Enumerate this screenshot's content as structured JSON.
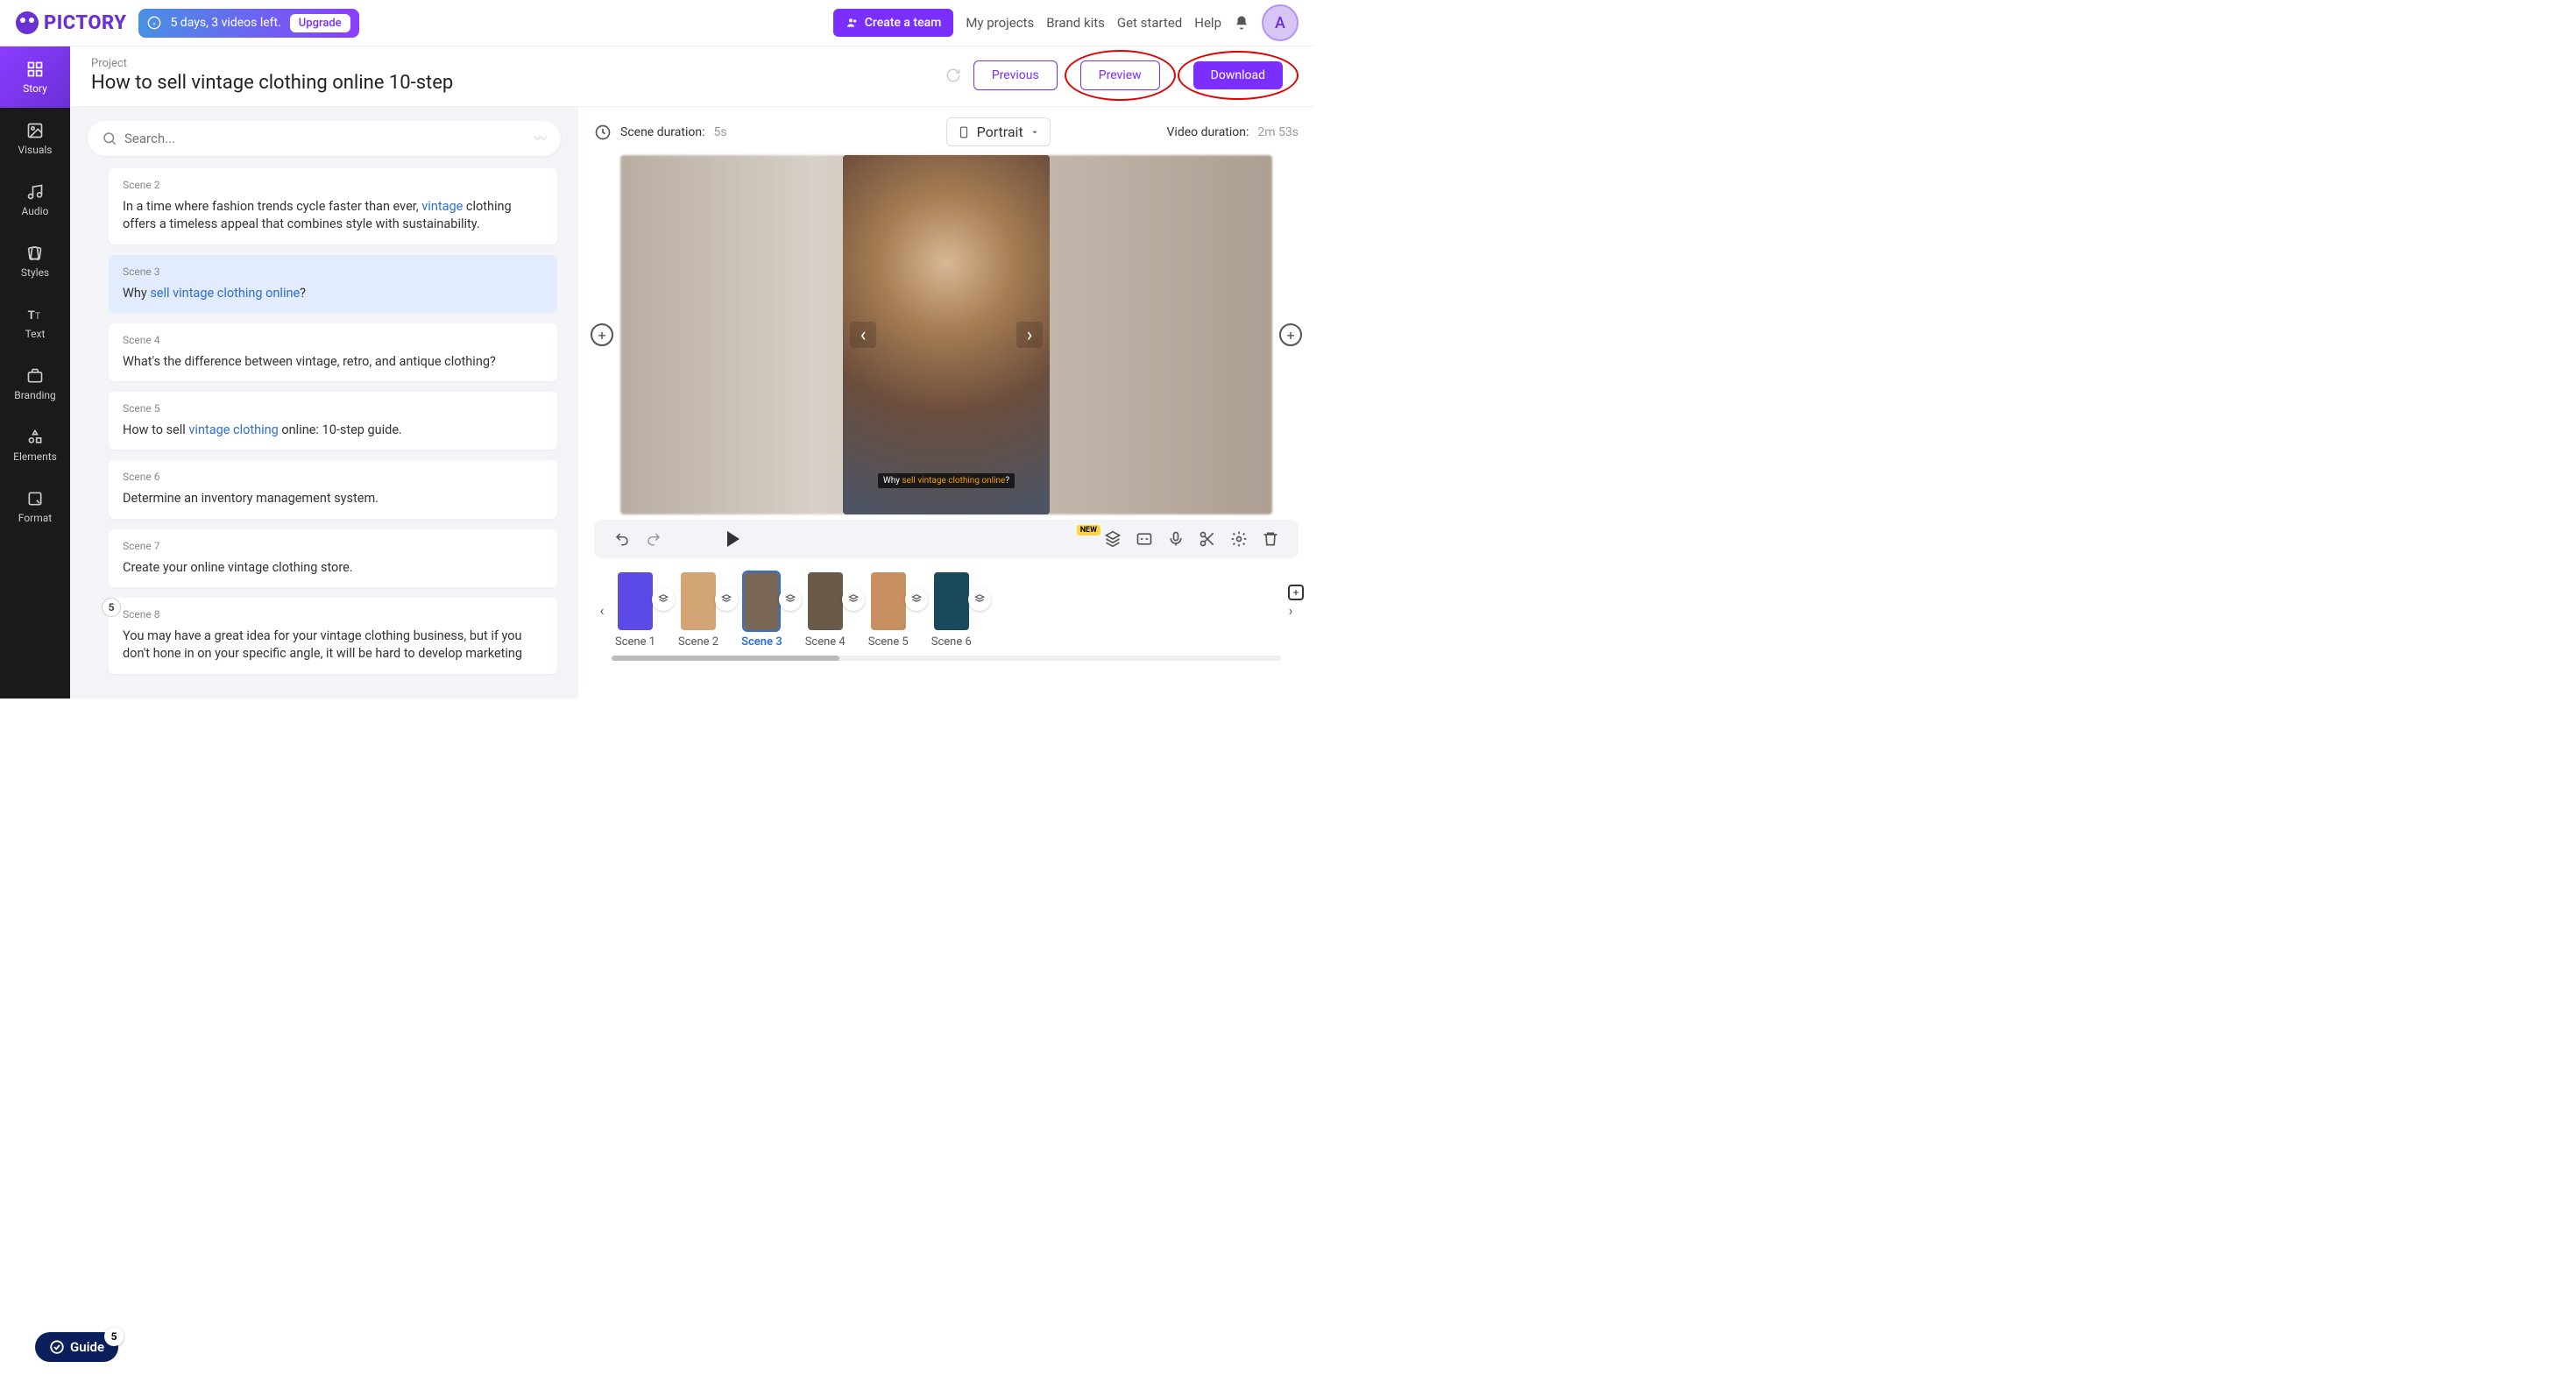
{
  "brand": "PICTORY",
  "trial": {
    "text": "5 days, 3 videos left.",
    "upgrade": "Upgrade"
  },
  "topnav": {
    "create_team": "Create a team",
    "my_projects": "My projects",
    "brand_kits": "Brand kits",
    "get_started": "Get started",
    "help": "Help"
  },
  "avatar_letter": "A",
  "project": {
    "label": "Project",
    "title": "How to sell vintage clothing online 10-step"
  },
  "header_buttons": {
    "previous": "Previous",
    "preview": "Preview",
    "download": "Download"
  },
  "sidebar": {
    "story": "Story",
    "visuals": "Visuals",
    "audio": "Audio",
    "styles": "Styles",
    "text": "Text",
    "branding": "Branding",
    "elements": "Elements",
    "format": "Format"
  },
  "search": {
    "placeholder": "Search..."
  },
  "scenes": [
    {
      "label": "Scene 2",
      "pre": "In a time where fashion trends cycle faster than ever, ",
      "hl": "vintage",
      "post": " clothing offers a timeless appeal that combines style with sustainability."
    },
    {
      "label": "Scene 3",
      "pre": "Why ",
      "hl": "sell vintage clothing online",
      "post": "?",
      "selected": true
    },
    {
      "label": "Scene 4",
      "pre": "What's the difference between vintage, retro, and antique clothing?",
      "hl": "",
      "post": ""
    },
    {
      "label": "Scene 5",
      "pre": "How to sell ",
      "hl": "vintage clothing",
      "post": " online: 10-step guide."
    },
    {
      "label": "Scene 6",
      "pre": "Determine an inventory management system.",
      "hl": "",
      "post": ""
    },
    {
      "label": "Scene 7",
      "pre": "Create your online vintage clothing store.",
      "hl": "",
      "post": ""
    },
    {
      "label": "Scene 8",
      "pre": "You may have a great idea for your vintage clothing business, but if you don't hone in on your specific angle, it will be hard to develop marketing",
      "hl": "",
      "post": "",
      "badge": "5"
    }
  ],
  "meta": {
    "scene_duration_label": "Scene duration:",
    "scene_duration_value": "5s",
    "orientation": "Portrait",
    "video_duration_label": "Video duration:",
    "video_duration_value": "2m 53s"
  },
  "caption": {
    "pre": "Why ",
    "hl": "sell vintage clothing online",
    "post": "?"
  },
  "toolbar": {
    "new_badge": "NEW"
  },
  "filmstrip": [
    {
      "label": "Scene 1"
    },
    {
      "label": "Scene 2"
    },
    {
      "label": "Scene 3",
      "active": true
    },
    {
      "label": "Scene 4"
    },
    {
      "label": "Scene 5"
    },
    {
      "label": "Scene 6"
    }
  ],
  "guide": {
    "label": "Guide",
    "count": "5"
  }
}
